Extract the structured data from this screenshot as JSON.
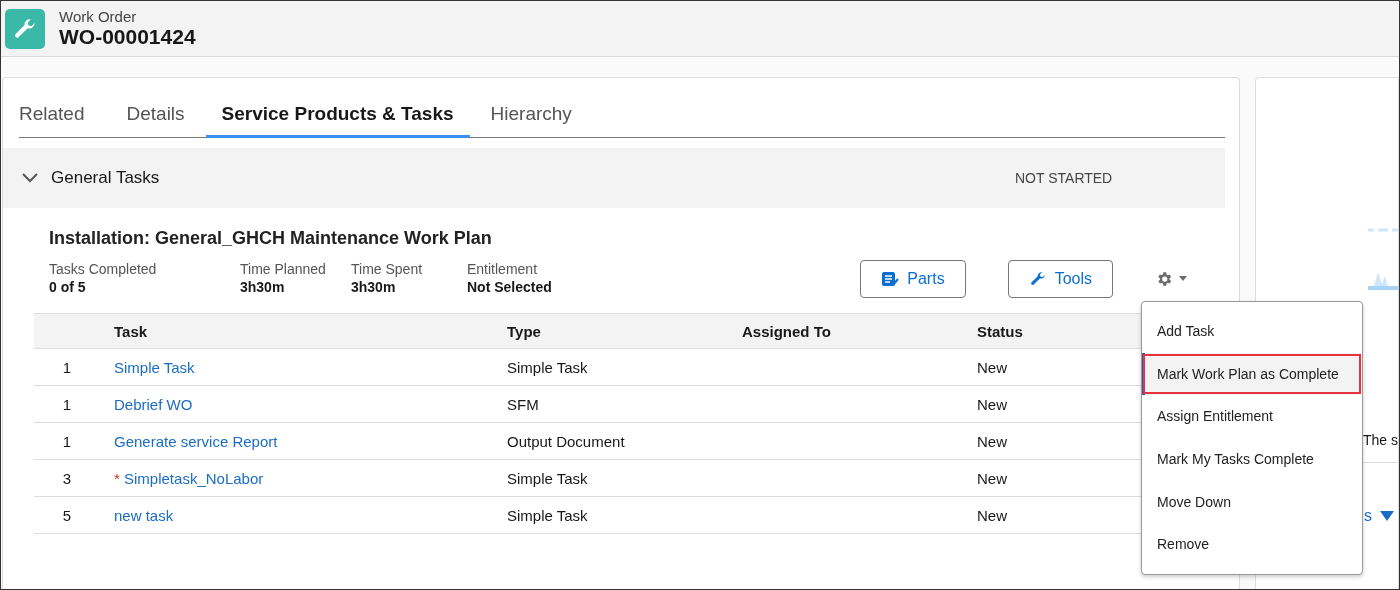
{
  "header": {
    "object_type": "Work Order",
    "record_name": "WO-00001424"
  },
  "tabs": [
    {
      "label": "Related",
      "selected": false
    },
    {
      "label": "Details",
      "selected": false
    },
    {
      "label": "Service Products & Tasks",
      "selected": true
    },
    {
      "label": "Hierarchy",
      "selected": false
    }
  ],
  "section": {
    "title": "General Tasks",
    "expanded": true,
    "status": "NOT STARTED"
  },
  "work_plan": {
    "title": "Installation: General_GHCH Maintenance Work Plan",
    "stats": [
      {
        "label": "Tasks Completed",
        "value": "0 of 5"
      },
      {
        "label": "Time Planned",
        "value": "3h30m"
      },
      {
        "label": "Time Spent",
        "value": "3h30m"
      },
      {
        "label": "Entitlement",
        "value": "Not Selected"
      }
    ],
    "buttons": [
      {
        "label": "Parts",
        "kind": "parts"
      },
      {
        "label": "Tools",
        "kind": "tools"
      }
    ]
  },
  "table": {
    "columns": [
      "Task",
      "Type",
      "Assigned To",
      "Status"
    ],
    "rows": [
      {
        "sequence": "1",
        "task": "Simple Task",
        "type": "Simple Task",
        "status": "New"
      },
      {
        "sequence": "1",
        "task": "Debrief WO",
        "type": "SFM",
        "status": "New"
      },
      {
        "sequence": "1",
        "task": "Generate service Report",
        "type": "Output Document",
        "status": "New"
      },
      {
        "sequence": "3",
        "task": "Simpletask_NoLabor",
        "required_mark": "*",
        "type": "Simple Task",
        "status": "New"
      },
      {
        "sequence": "5",
        "task": "new task",
        "type": "Simple Task",
        "status": "New"
      }
    ]
  },
  "menu": {
    "items": [
      {
        "label": "Add Task",
        "selected": false
      },
      {
        "label": "Mark Work Plan as Complete",
        "selected": true
      },
      {
        "label": "Assign Entitlement",
        "selected": false
      },
      {
        "label": "Mark My Tasks Complete",
        "selected": false
      },
      {
        "label": "Move Down",
        "selected": false
      },
      {
        "label": "Remove",
        "selected": false
      }
    ]
  },
  "side_panel": {
    "text": "The s",
    "link": "s"
  }
}
